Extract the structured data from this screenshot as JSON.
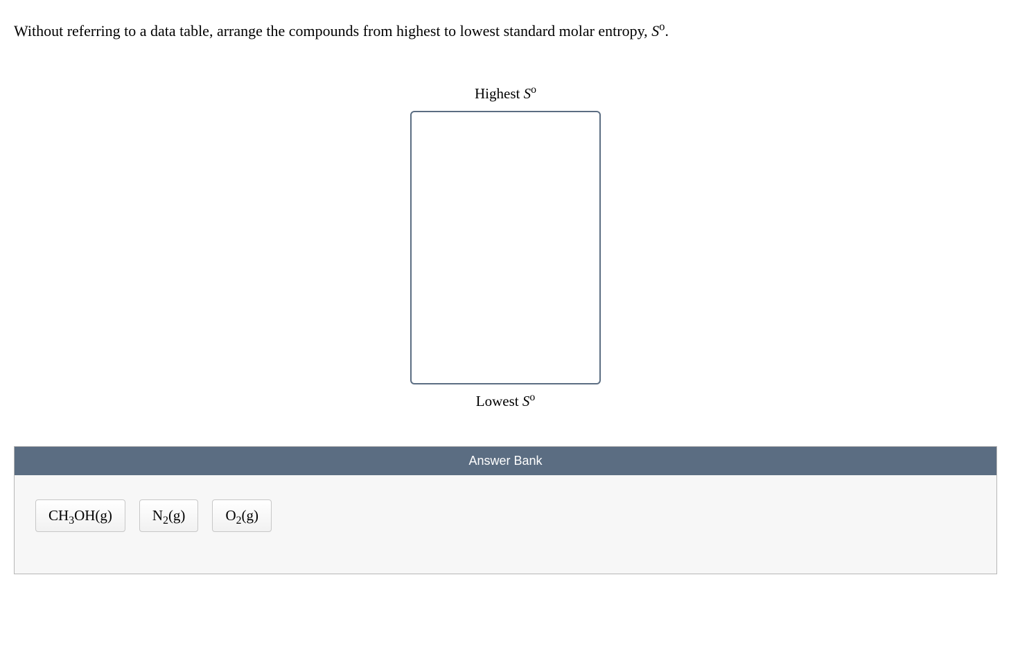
{
  "question": {
    "prefix": "Without referring to a data table, arrange the compounds from highest to lowest standard molar entropy, ",
    "symbol_italic": "S",
    "symbol_super": "o",
    "suffix": "."
  },
  "labels": {
    "highest_prefix": "Highest ",
    "highest_italic": "S",
    "highest_super": "o",
    "lowest_prefix": "Lowest ",
    "lowest_italic": "S",
    "lowest_super": "o"
  },
  "answer_bank": {
    "title": "Answer Bank",
    "items": [
      {
        "p1": "CH",
        "sub1": "3",
        "p2": "OH(g)"
      },
      {
        "p1": "N",
        "sub1": "2",
        "p2": "(g)"
      },
      {
        "p1": "O",
        "sub1": "2",
        "p2": "(g)"
      }
    ]
  }
}
